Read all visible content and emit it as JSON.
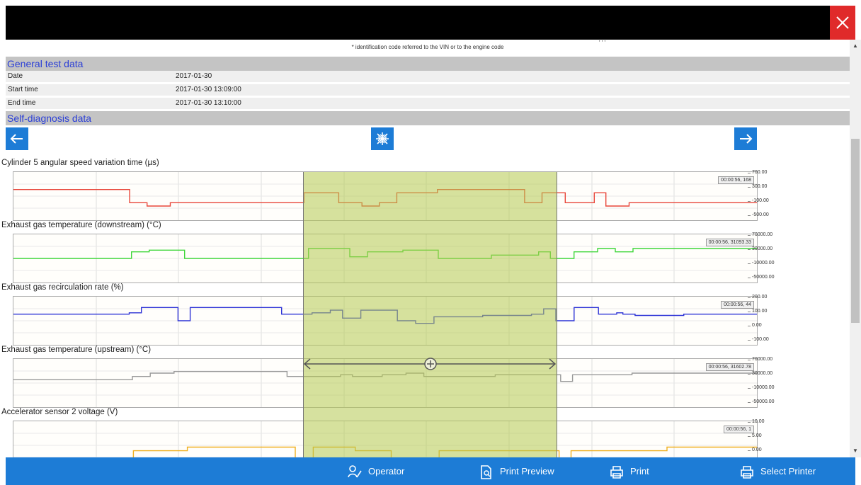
{
  "window": {
    "close_icon": "close-icon",
    "accent": "#e02a2a"
  },
  "note": "* identification code referred to the VIN or to the engine code",
  "note_tick": "' '  '",
  "general": {
    "header": "General test data",
    "rows": [
      {
        "label": "Date",
        "value": "2017-01-30"
      },
      {
        "label": "Start time",
        "value": "2017-01-30 13:09:00"
      },
      {
        "label": "End time",
        "value": "2017-01-30 13:10:00"
      }
    ]
  },
  "self_diag": {
    "header": "Self-diagnosis data"
  },
  "nav": {
    "prev_icon": "arrow-left-icon",
    "center_icon": "collapse-icon",
    "next_icon": "arrow-right-icon"
  },
  "charts": [
    {
      "title": "Cylinder 5 angular speed variation time (µs)",
      "color": "#e8463a",
      "ticks": [
        "700.00",
        "300.00",
        "-100.00",
        "-500.00"
      ],
      "readout": "00:00:56, 168",
      "ylim": [
        -500,
        700
      ],
      "values": [
        300,
        300,
        300,
        300,
        300,
        300,
        300,
        300,
        300,
        300,
        300,
        300,
        300,
        300,
        300,
        300,
        300,
        300,
        300,
        300,
        -100,
        -100,
        -100,
        -200,
        -200,
        -200,
        -200,
        -100,
        -100,
        -100,
        -100,
        -100,
        -100,
        -100,
        -100,
        -100,
        -100,
        -100,
        -100,
        -100,
        -100,
        -100,
        -100,
        -100,
        -100,
        -100,
        -100,
        -100,
        -100,
        -100,
        200,
        200,
        200,
        200,
        200,
        200,
        -100,
        -100,
        -100,
        -100,
        -200,
        -200,
        -200,
        -100,
        -100,
        -100,
        200,
        200,
        200,
        200,
        200,
        200,
        200,
        300,
        300,
        300,
        300,
        300,
        300,
        300,
        300,
        300,
        300,
        300,
        300,
        300,
        300,
        300,
        -100,
        -100,
        -100,
        200,
        200,
        200,
        200,
        -100,
        -100,
        -100,
        -100,
        -100,
        200,
        200,
        -200,
        -200,
        -200,
        -200,
        -100,
        -100,
        -100,
        -100,
        -100,
        -100,
        -100,
        -100,
        -100,
        -100,
        -100,
        -100,
        -100,
        -100,
        -100,
        -100,
        -100,
        -100,
        -100,
        -100,
        -100,
        -100
      ]
    },
    {
      "title": "Exhaust gas temperature (downstream) (°C)",
      "color": "#3ed63a",
      "ticks": [
        "70000.00",
        "30000.00",
        "-10000.00",
        "-50000.00"
      ],
      "readout": "00:00:56, 31093.33",
      "ylim": [
        -50000,
        70000
      ],
      "values": [
        10000,
        10000,
        10000,
        10000,
        10000,
        10000,
        10000,
        10000,
        10000,
        10000,
        10000,
        10000,
        10000,
        10000,
        10000,
        10000,
        10000,
        10000,
        10000,
        10000,
        30000,
        30000,
        30000,
        35000,
        35000,
        35000,
        35000,
        35000,
        35000,
        10000,
        10000,
        10000,
        10000,
        10000,
        10000,
        10000,
        10000,
        10000,
        10000,
        10000,
        10000,
        10000,
        10000,
        10000,
        10000,
        10000,
        10000,
        10000,
        10000,
        10000,
        40000,
        40000,
        40000,
        40000,
        40000,
        40000,
        40000,
        15000,
        15000,
        15000,
        30000,
        30000,
        30000,
        30000,
        30000,
        30000,
        35000,
        35000,
        35000,
        35000,
        35000,
        35000,
        10000,
        10000,
        10000,
        10000,
        10000,
        10000,
        10000,
        10000,
        10000,
        20000,
        20000,
        20000,
        20000,
        20000,
        20000,
        20000,
        20000,
        30000,
        30000,
        10000,
        10000,
        10000,
        10000,
        30000,
        30000,
        30000,
        30000,
        40000,
        40000,
        40000,
        30000,
        30000,
        30000,
        40000,
        40000,
        40000,
        40000,
        40000,
        40000,
        40000,
        40000,
        40000,
        40000,
        40000,
        40000,
        40000,
        40000,
        40000,
        40000,
        40000,
        40000,
        40000,
        40000,
        40000
      ]
    },
    {
      "title": "Exhaust gas recirculation rate (%)",
      "color": "#2d33d6",
      "ticks": [
        "200.00",
        "100.00",
        "0.00",
        "-100.00"
      ],
      "readout": "00:00:56, 44",
      "ylim": [
        -100,
        200
      ],
      "values": [
        100,
        100,
        100,
        100,
        100,
        100,
        100,
        100,
        100,
        100,
        100,
        100,
        100,
        100,
        100,
        100,
        100,
        100,
        100,
        110,
        110,
        150,
        150,
        150,
        150,
        150,
        150,
        50,
        50,
        150,
        150,
        150,
        150,
        150,
        150,
        150,
        150,
        150,
        150,
        150,
        150,
        150,
        150,
        150,
        100,
        100,
        100,
        100,
        100,
        110,
        110,
        110,
        130,
        130,
        70,
        70,
        70,
        130,
        130,
        130,
        130,
        130,
        130,
        50,
        50,
        50,
        30,
        30,
        30,
        80,
        80,
        80,
        80,
        80,
        80,
        80,
        80,
        90,
        90,
        90,
        90,
        90,
        90,
        90,
        90,
        100,
        100,
        140,
        140,
        50,
        50,
        50,
        150,
        150,
        150,
        150,
        100,
        100,
        100,
        110,
        100,
        100,
        90,
        90,
        90,
        90,
        90,
        90,
        90,
        90,
        100,
        100,
        100,
        100,
        100,
        100,
        100,
        100,
        100,
        100,
        100,
        100
      ]
    },
    {
      "title": "Exhaust gas temperature (upstream) (°C)",
      "color": "#999999",
      "ticks": [
        "70000.00",
        "30000.00",
        "-10000.00",
        "-50000.00"
      ],
      "readout": "00:00:56, 31602.78",
      "ylim": [
        -50000,
        70000
      ],
      "values": [
        20000,
        20000,
        20000,
        20000,
        20000,
        20000,
        20000,
        20000,
        20000,
        20000,
        20000,
        20000,
        20000,
        20000,
        20000,
        20000,
        20000,
        20000,
        20000,
        20000,
        30000,
        30000,
        30000,
        40000,
        40000,
        40000,
        40000,
        45000,
        45000,
        45000,
        45000,
        45000,
        45000,
        45000,
        45000,
        45000,
        45000,
        45000,
        45000,
        45000,
        45000,
        45000,
        45000,
        45000,
        45000,
        45000,
        30000,
        30000,
        30000,
        30000,
        30000,
        30000,
        30000,
        30000,
        30000,
        35000,
        35000,
        30000,
        30000,
        30000,
        30000,
        30000,
        35000,
        35000,
        35000,
        35000,
        40000,
        40000,
        40000,
        30000,
        30000,
        30000,
        30000,
        30000,
        30000,
        30000,
        30000,
        30000,
        30000,
        30000,
        30000,
        35000,
        35000,
        35000,
        35000,
        35000,
        35000,
        35000,
        35000,
        35000,
        35000,
        35000,
        15000,
        15000,
        35000,
        35000,
        35000,
        35000,
        35000,
        35000,
        35000,
        35000,
        35000,
        35000,
        40000,
        40000,
        40000,
        40000,
        40000,
        40000,
        40000,
        40000,
        40000,
        40000,
        40000,
        40000,
        40000,
        40000,
        40000,
        40000,
        40000,
        40000,
        40000,
        40000,
        40000
      ]
    },
    {
      "title": "Accelerator sensor 2 voltage (V)",
      "color": "#f0b020",
      "ticks": [
        "10.00",
        "5.00",
        "0.00"
      ],
      "readout": "00:00:56, 1",
      "ylim": [
        -1,
        10
      ],
      "values": [
        1,
        1,
        1,
        1,
        1,
        1,
        1,
        1,
        1,
        1,
        1,
        1,
        1,
        1,
        1,
        1,
        1,
        1,
        1,
        1,
        3,
        3,
        3,
        3,
        3,
        3,
        3,
        3,
        3,
        4,
        4,
        4,
        4,
        4,
        4,
        4,
        4,
        4,
        4,
        4,
        4,
        4,
        4,
        4,
        4,
        4,
        4,
        1,
        1,
        1,
        4,
        4,
        4,
        4,
        4,
        4,
        4,
        3,
        3,
        3,
        3,
        3,
        3,
        1,
        1,
        1,
        1,
        1,
        1,
        1,
        1,
        3,
        3,
        3,
        3,
        3,
        3,
        3,
        3,
        3,
        3,
        3,
        3,
        3,
        3,
        3,
        3,
        3,
        3,
        3,
        3,
        1,
        1,
        3,
        3,
        3,
        3,
        3,
        3,
        3,
        3,
        3,
        3,
        3,
        3,
        3,
        3,
        3,
        3,
        4,
        4,
        4,
        4,
        4,
        4,
        4,
        4,
        4,
        4,
        4,
        4,
        4,
        4,
        4
      ]
    }
  ],
  "bottom": {
    "operator": "Operator",
    "print_preview": "Print Preview",
    "print": "Print",
    "select_printer": "Select Printer"
  }
}
